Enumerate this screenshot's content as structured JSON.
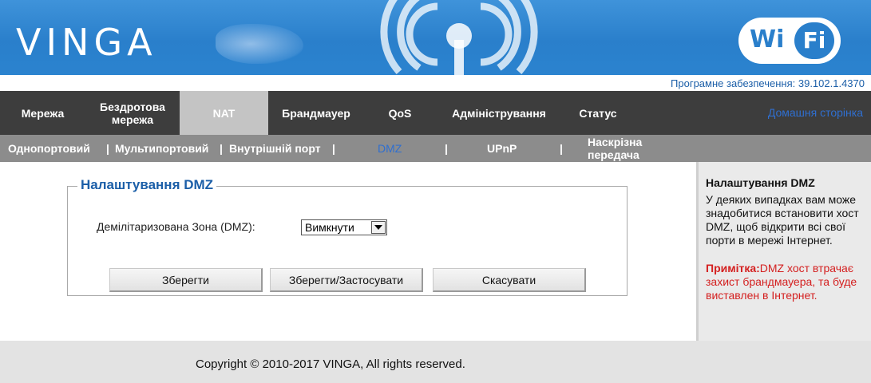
{
  "header": {
    "logo": "VINGA",
    "wifi_left": "Wi",
    "wifi_right": "Fi"
  },
  "firmware": "Програмне забезпечення: 39.102.1.4370",
  "mainnav": {
    "items": [
      {
        "label": "Мережа"
      },
      {
        "label": "Бездротова мережа"
      },
      {
        "label": "NAT"
      },
      {
        "label": "Брандмауер"
      },
      {
        "label": "QoS"
      },
      {
        "label": "Адміністрування"
      },
      {
        "label": "Статус"
      }
    ],
    "active": "NAT",
    "home": "Домашня сторінка"
  },
  "subnav": {
    "items": [
      {
        "label": "Однопортовий"
      },
      {
        "label": "Мультипортовий"
      },
      {
        "label": "Внутрішній порт"
      },
      {
        "label": "DMZ"
      },
      {
        "label": "UPnP"
      },
      {
        "label": "Наскрізна передача"
      }
    ],
    "separator": "|",
    "active": "DMZ"
  },
  "dmz": {
    "legend": "Налаштування DMZ",
    "field_label": "Демілітаризована Зона (DMZ):",
    "select_value": "Вимкнути",
    "buttons": {
      "save": "Зберегти",
      "save_apply": "Зберегти/Застосувати",
      "cancel": "Скасувати"
    }
  },
  "help": {
    "title": "Налаштування DMZ",
    "body": "У деяких випадках вам може знадобитися встановити хост DMZ, щоб відкрити всі свої порти в мережі Інтернет.",
    "note_label": "Примітка:",
    "note_text": "DMZ хост втрачає захист брандмауера, та буде виставлен в Інтернет."
  },
  "footer": {
    "copyright": "Copyright © 2010-2017 VINGA, All rights reserved."
  },
  "colors": {
    "header_blue": "#2a7fcb",
    "nav_dark": "#3d3d3d",
    "nav_active": "#c4c4c4",
    "subnav_grey": "#8c8c8c",
    "link_blue": "#2f6fd0",
    "note_red": "#d42020"
  }
}
